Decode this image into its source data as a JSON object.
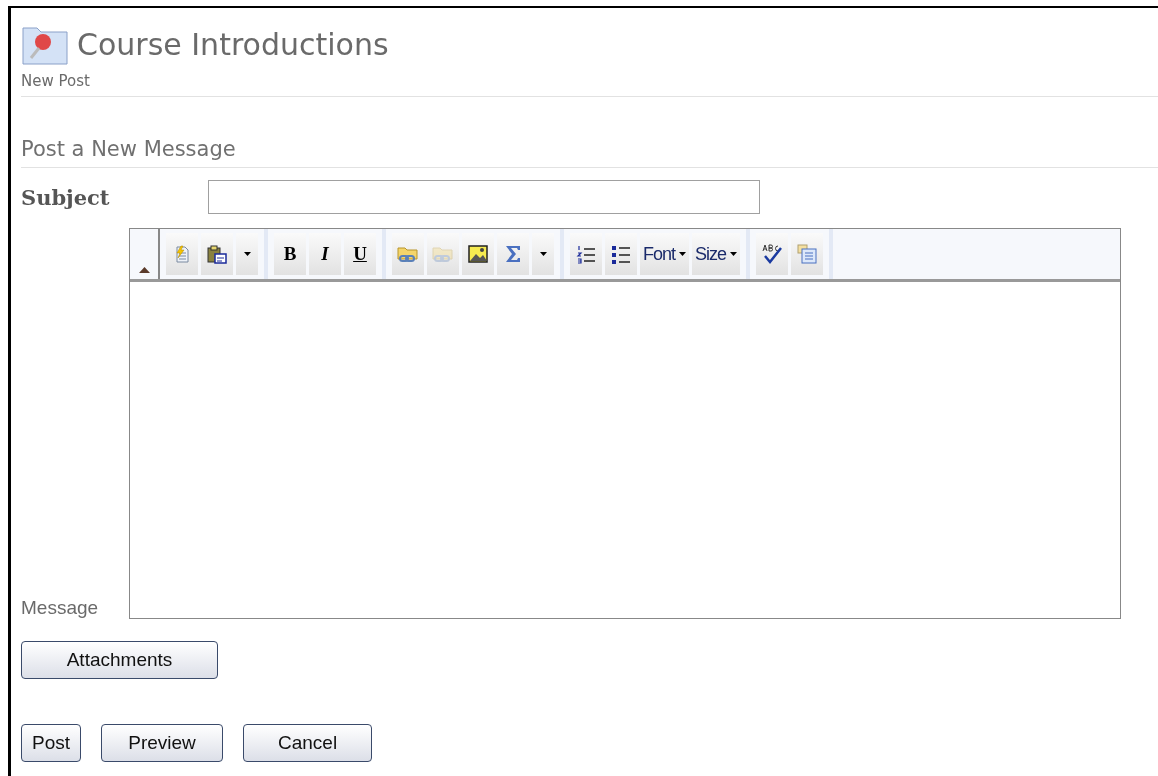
{
  "header": {
    "title": "Course Introductions",
    "subtitle": "New Post"
  },
  "section_title": "Post a New Message",
  "subject": {
    "label": "Subject"
  },
  "editor": {
    "label": "Message",
    "toolbar": [
      [
        {
          "kind": "note",
          "disabled": false
        },
        {
          "kind": "paste",
          "disabled": false
        },
        {
          "kind": "menu",
          "disabled": false
        }
      ],
      [
        {
          "kind": "bold",
          "label": "B",
          "disabled": false
        },
        {
          "kind": "italic",
          "label": "I",
          "disabled": false
        },
        {
          "kind": "underline",
          "label": "U",
          "disabled": false
        }
      ],
      [
        {
          "kind": "link",
          "disabled": false
        },
        {
          "kind": "link",
          "disabled": true
        },
        {
          "kind": "image",
          "disabled": false
        },
        {
          "kind": "sigma",
          "disabled": false
        },
        {
          "kind": "menu",
          "disabled": false
        }
      ],
      [
        {
          "kind": "numbered",
          "disabled": false
        },
        {
          "kind": "bulleted",
          "disabled": false
        },
        {
          "kind": "select",
          "label": "Font",
          "disabled": false
        },
        {
          "kind": "select",
          "label": "Size",
          "disabled": false
        }
      ],
      [
        {
          "kind": "spell",
          "disabled": false
        },
        {
          "kind": "template",
          "disabled": false
        }
      ]
    ]
  },
  "attachments_button": "Attachments",
  "actions": [
    "Post",
    "Preview",
    "Cancel"
  ]
}
